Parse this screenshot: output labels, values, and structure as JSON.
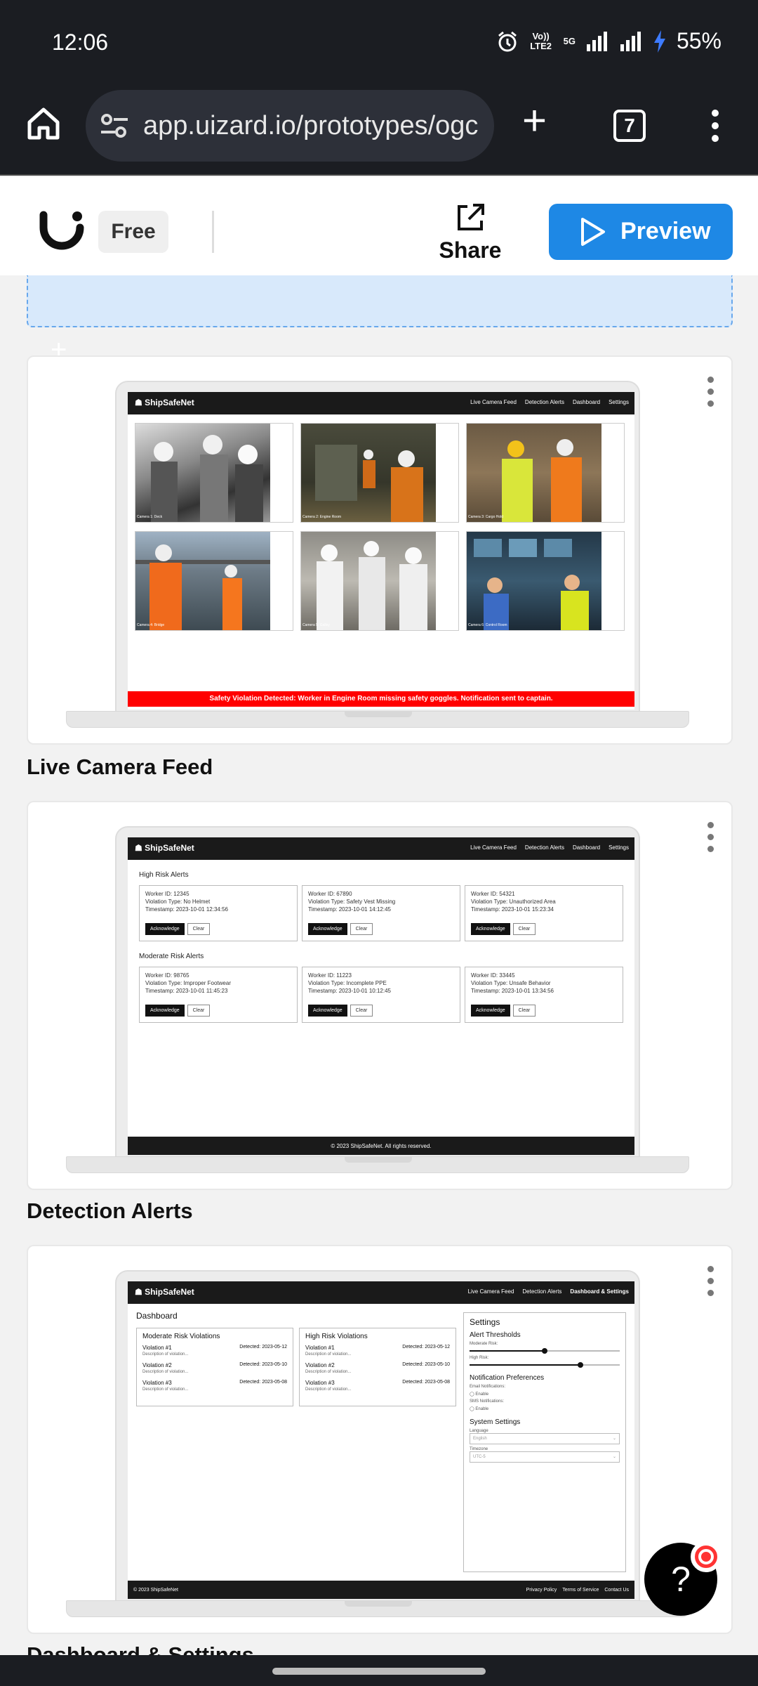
{
  "status": {
    "time": "12:06",
    "network_top": "Vo)) LTE2",
    "signal_5g": "5G",
    "battery": "55%"
  },
  "browser": {
    "url": "app.uizard.io/prototypes/ogc",
    "tab_count": "7"
  },
  "app_header": {
    "plan": "Free",
    "share": "Share",
    "preview": "Preview"
  },
  "screens": [
    {
      "title": "Live Camera Feed"
    },
    {
      "title": "Detection Alerts"
    },
    {
      "title": "Dashboard & Settings"
    }
  ],
  "site": {
    "brand": "ShipSafeNet",
    "nav": [
      "Live Camera Feed",
      "Detection Alerts",
      "Dashboard",
      "Settings"
    ],
    "nav3": [
      "Live Camera Feed",
      "Detection Alerts",
      "Dashboard & Settings"
    ]
  },
  "cameras": [
    {
      "label": "Camera 1: Deck"
    },
    {
      "label": "Camera 2: Engine Room"
    },
    {
      "label": "Camera 3: Cargo Hold"
    },
    {
      "label": "Camera 4: Bridge"
    },
    {
      "label": "Camera 5: Galley"
    },
    {
      "label": "Camera 6: Control Room"
    }
  ],
  "violation_banner": "Safety Violation Detected: Worker in Engine Room missing safety goggles. Notification sent to captain.",
  "alerts": {
    "high_title": "High Risk Alerts",
    "moderate_title": "Moderate Risk Alerts",
    "ack": "Acknowledge",
    "clear": "Clear",
    "high": [
      {
        "worker": "Worker ID: 12345",
        "type": "Violation Type: No Helmet",
        "ts": "Timestamp: 2023-10-01 12:34:56"
      },
      {
        "worker": "Worker ID: 67890",
        "type": "Violation Type: Safety Vest Missing",
        "ts": "Timestamp: 2023-10-01 14:12:45"
      },
      {
        "worker": "Worker ID: 54321",
        "type": "Violation Type: Unauthorized Area",
        "ts": "Timestamp: 2023-10-01 15:23:34"
      }
    ],
    "moderate": [
      {
        "worker": "Worker ID: 98765",
        "type": "Violation Type: Improper Footwear",
        "ts": "Timestamp: 2023-10-01 11:45:23"
      },
      {
        "worker": "Worker ID: 11223",
        "type": "Violation Type: Incomplete PPE",
        "ts": "Timestamp: 2023-10-01 10:12:45"
      },
      {
        "worker": "Worker ID: 33445",
        "type": "Violation Type: Unsafe Behavior",
        "ts": "Timestamp: 2023-10-01 13:34:56"
      }
    ],
    "footer": "© 2023 ShipSafeNet. All rights reserved."
  },
  "dashboard": {
    "title": "Dashboard",
    "moderate_title": "Moderate Risk Violations",
    "high_title": "High Risk Violations",
    "violations": [
      {
        "name": "Violation #1",
        "date": "Detected: 2023-05-12",
        "desc": "Description of violation..."
      },
      {
        "name": "Violation #2",
        "date": "Detected: 2023-05-10",
        "desc": "Description of violation..."
      },
      {
        "name": "Violation #3",
        "date": "Detected: 2023-05-08",
        "desc": "Description of violation..."
      }
    ],
    "settings_title": "Settings",
    "alert_thresholds": "Alert Thresholds",
    "moderate_risk": "Moderate Risk:",
    "moderate_level": 0.5,
    "high_risk": "High Risk:",
    "high_level": 0.74,
    "notif_title": "Notification Preferences",
    "email_label": "Email Notifications:",
    "sms_label": "SMS Notifications:",
    "enable": "Enable",
    "system_title": "System Settings",
    "language_label": "Language",
    "language_value": "English",
    "timezone_label": "Timezone",
    "timezone_value": "UTC-5",
    "footer_left": "© 2023 ShipSafeNet",
    "footer_links": [
      "Privacy Policy",
      "Terms of Service",
      "Contact Us"
    ]
  }
}
